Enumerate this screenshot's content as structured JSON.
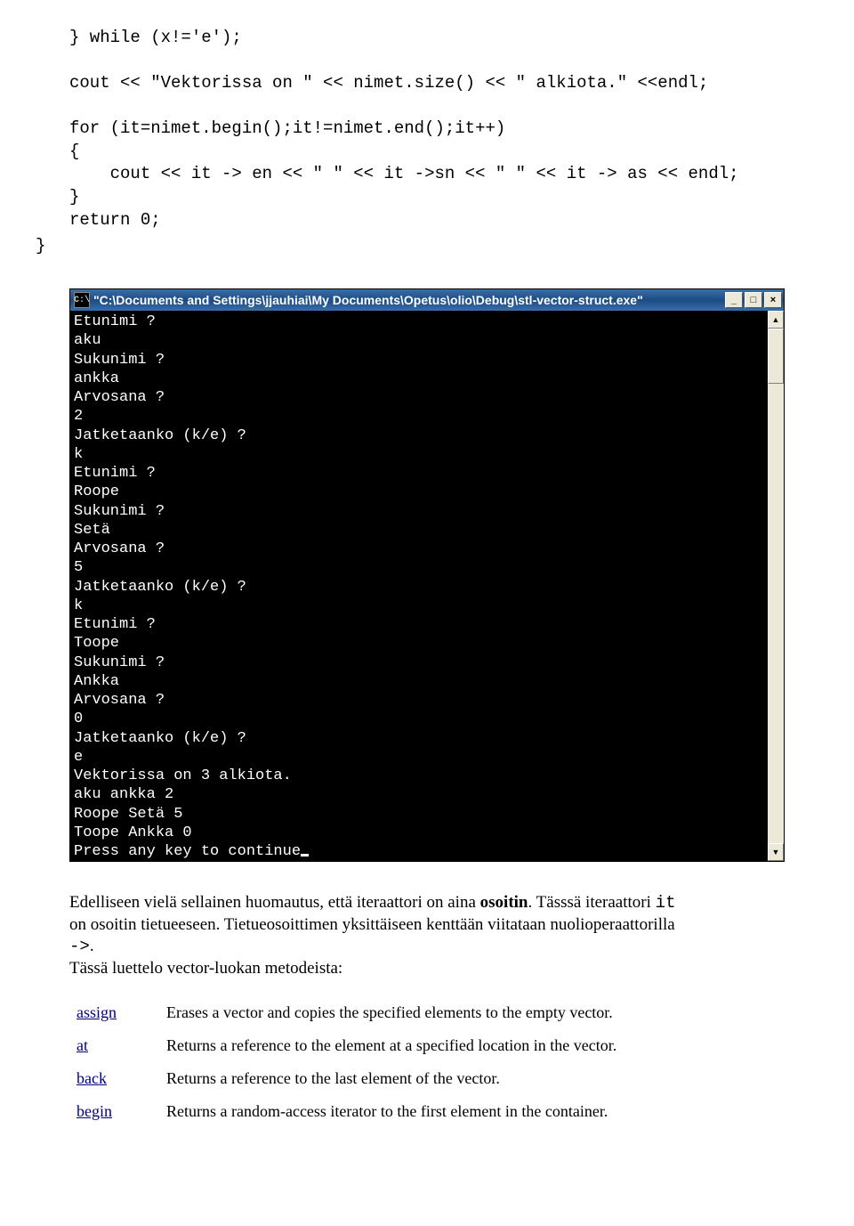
{
  "code": {
    "lines": [
      "} while (x!='e');",
      "",
      "cout << \"Vektorissa on \" << nimet.size() << \" alkiota.\" <<endl;",
      "",
      "for (it=nimet.begin();it!=nimet.end();it++)",
      "{",
      "    cout << it -> en << \" \" << it ->sn << \" \" << it -> as << endl;",
      "}",
      "return 0;"
    ],
    "close": "}"
  },
  "console": {
    "sysicon_text": "C:\\",
    "title": "\"C:\\Documents and Settings\\jjauhiai\\My Documents\\Opetus\\olio\\Debug\\stl-vector-struct.exe\"",
    "minimize": "_",
    "maximize": "□",
    "close": "×",
    "scroll_up": "▲",
    "scroll_down": "▼",
    "output_lines": [
      "Etunimi ?",
      "aku",
      "Sukunimi ?",
      "ankka",
      "Arvosana ?",
      "2",
      "Jatketaanko (k/e) ?",
      "k",
      "Etunimi ?",
      "Roope",
      "Sukunimi ?",
      "Setä",
      "Arvosana ?",
      "5",
      "Jatketaanko (k/e) ?",
      "k",
      "Etunimi ?",
      "Toope",
      "Sukunimi ?",
      "Ankka",
      "Arvosana ?",
      "0",
      "Jatketaanko (k/e) ?",
      "e",
      "Vektorissa on 3 alkiota.",
      "aku ankka 2",
      "Roope Setä 5",
      "Toope Ankka 0"
    ],
    "output_last": "Press any key to continue"
  },
  "paragraph": {
    "p1a": "Edelliseen vielä sellainen huomautus, että iteraattori on aina ",
    "p1b_bold": "osoitin",
    "p1c": ". Tässsä iteraattori ",
    "p1d_mono": "it",
    "p2a": "on osoitin tietueeseen. Tietueosoittimen yksittäiseen kenttään viitataan nuolioperaattorilla",
    "p2b_mono": "->",
    "p2c": ".",
    "p3": "Tässä luettelo vector-luokan metodeista:"
  },
  "table": {
    "rows": [
      {
        "name": "assign",
        "desc": "Erases a vector and copies the specified elements to the empty vector."
      },
      {
        "name": "at",
        "desc": "Returns a reference to the element at a specified location in the vector."
      },
      {
        "name": "back",
        "desc": "Returns a reference to the last element of the vector."
      },
      {
        "name": "begin",
        "desc": "Returns a random-access iterator to the first element in the container."
      }
    ]
  }
}
